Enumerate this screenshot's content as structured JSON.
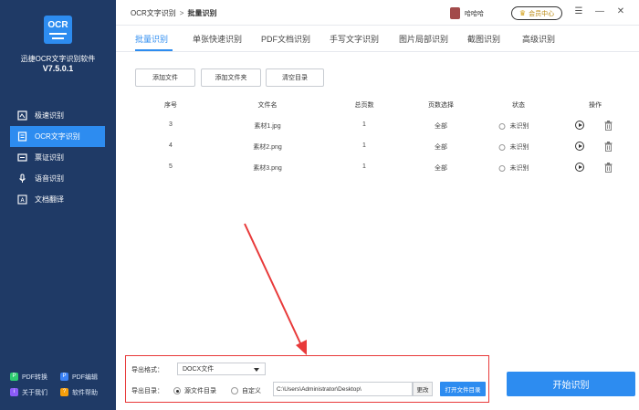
{
  "app": {
    "logo_text": "OCR",
    "name": "迅捷OCR文字识别软件",
    "version": "V7.5.0.1"
  },
  "sidebar": {
    "items": [
      {
        "label": "极速识别",
        "icon": "image-scan-icon",
        "active": false
      },
      {
        "label": "OCR文字识别",
        "icon": "document-ocr-icon",
        "active": true
      },
      {
        "label": "票证识别",
        "icon": "ticket-icon",
        "active": false
      },
      {
        "label": "语音识别",
        "icon": "microphone-icon",
        "active": false
      },
      {
        "label": "文档翻译",
        "icon": "translate-icon",
        "active": false
      }
    ],
    "footer": [
      {
        "label": "PDF转换",
        "color": "#2ecc71"
      },
      {
        "label": "PDF编辑",
        "color": "#3b82f6"
      },
      {
        "label": "关于我们",
        "color": "#8b5cf6"
      },
      {
        "label": "软件帮助",
        "color": "#f59e0b"
      }
    ]
  },
  "header": {
    "breadcrumb_root": "OCR文字识别",
    "breadcrumb_sep": ">",
    "breadcrumb_current": "批量识别",
    "username": "哈哈哈",
    "member_label": "会员中心"
  },
  "tabs": [
    {
      "label": "批量识别",
      "active": true
    },
    {
      "label": "单张快速识别",
      "active": false
    },
    {
      "label": "PDF文档识别",
      "active": false
    },
    {
      "label": "手写文字识别",
      "active": false
    },
    {
      "label": "图片局部识别",
      "active": false
    },
    {
      "label": "截图识别",
      "active": false
    },
    {
      "label": "高级识别",
      "active": false
    }
  ],
  "toolbar": {
    "add_file": "添加文件",
    "add_folder": "添加文件夹",
    "clear_list": "清空目录"
  },
  "table": {
    "headers": [
      "序号",
      "文件名",
      "总页数",
      "页数选择",
      "状态",
      "操作"
    ],
    "rows": [
      {
        "index": "3",
        "filename": "素材1.jpg",
        "pages": "1",
        "page_select": "全部",
        "status": "未识别"
      },
      {
        "index": "4",
        "filename": "素材2.png",
        "pages": "1",
        "page_select": "全部",
        "status": "未识别"
      },
      {
        "index": "5",
        "filename": "素材3.png",
        "pages": "1",
        "page_select": "全部",
        "status": "未识别"
      }
    ]
  },
  "export": {
    "format_label": "导出格式：",
    "format_value": "DOCX文件",
    "dir_label": "导出目录：",
    "option_source": "源文件目录",
    "option_custom": "自定义",
    "path": "C:\\Users\\Administrator\\Desktop\\",
    "change_label": "更改",
    "open_dir_label": "打开文件目录"
  },
  "start_button": "开始识别",
  "colors": {
    "sidebar_bg": "#1f3a66",
    "accent": "#2d8cf0",
    "highlight_border": "#e83a3a"
  }
}
